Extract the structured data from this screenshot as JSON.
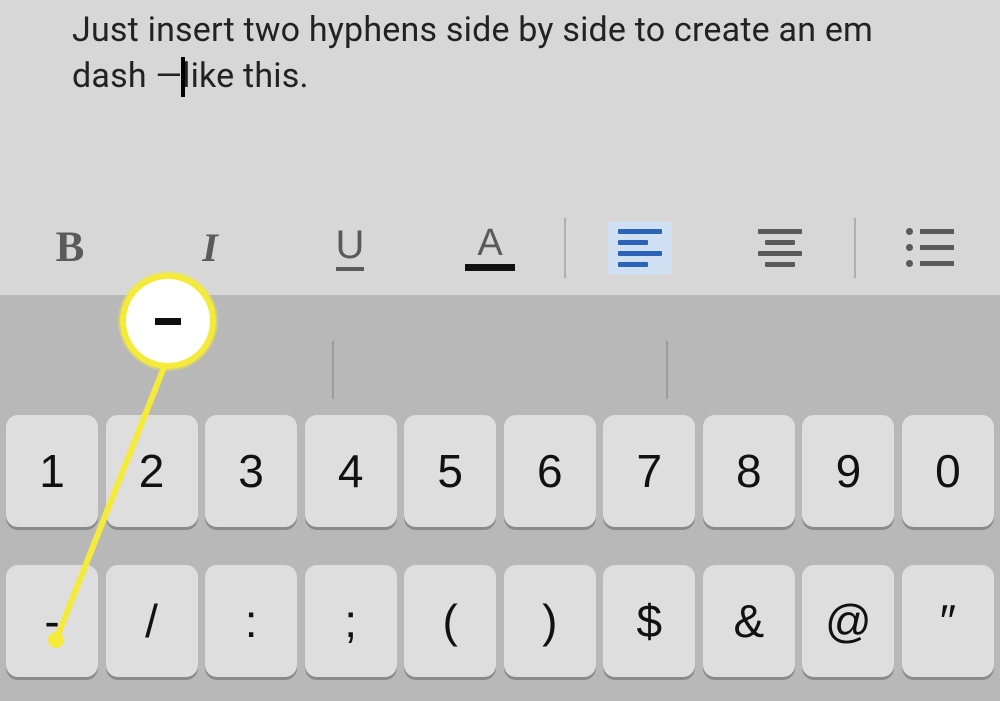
{
  "document": {
    "text_before_caret": "Just insert two hyphens side by side to create an em dash —",
    "text_after_caret": "like this."
  },
  "toolbar": {
    "bold_label": "B",
    "italic_label": "I",
    "underline_label": "U",
    "text_color_label": "A"
  },
  "callout": {
    "symbol": "-"
  },
  "keyboard": {
    "row1": [
      "1",
      "2",
      "3",
      "4",
      "5",
      "6",
      "7",
      "8",
      "9",
      "0"
    ],
    "row2": [
      "-",
      "/",
      ":",
      ";",
      "(",
      ")",
      "$",
      "&",
      "@",
      "″"
    ]
  }
}
